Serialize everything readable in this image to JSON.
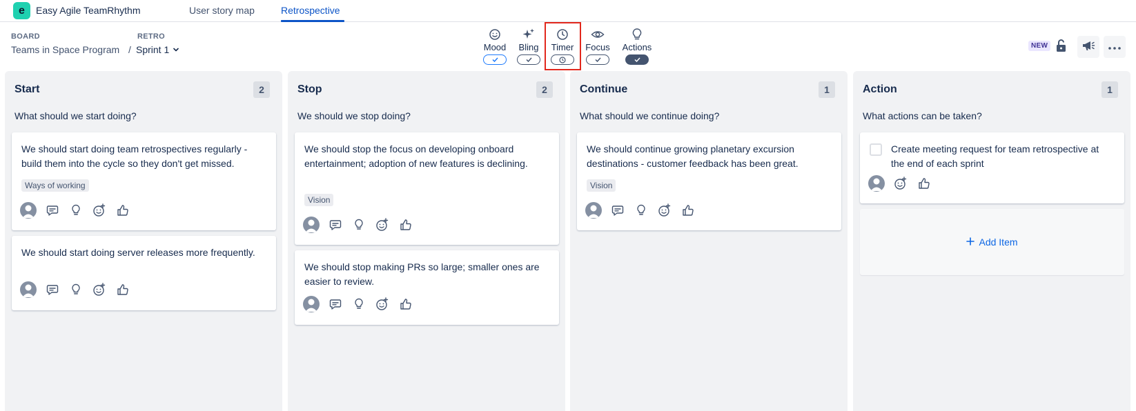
{
  "app": {
    "name": "Easy Agile TeamRhythm",
    "logo_letter": "e"
  },
  "nav": {
    "tabs": [
      {
        "label": "User story map"
      },
      {
        "label": "Retrospective"
      }
    ],
    "active_tab": "Retrospective"
  },
  "breadcrumb": {
    "board_label": "BOARD",
    "board_value": "Teams in Space Program",
    "separator": "/",
    "retro_label": "RETRO",
    "retro_value": "Sprint 1"
  },
  "toolbar": {
    "mood": "Mood",
    "bling": "Bling",
    "timer": "Timer",
    "focus": "Focus",
    "actions": "Actions",
    "highlighted": "Timer"
  },
  "header_right": {
    "new_badge": "NEW"
  },
  "columns": [
    {
      "title": "Start",
      "count": "2",
      "subtitle": "What should we start doing?",
      "cards": [
        {
          "text": "We should start doing team retrospectives regularly - build them into the cycle so they don't get missed.",
          "tag": "Ways of working"
        },
        {
          "text": "We should start doing server releases more frequently.",
          "tag": ""
        }
      ]
    },
    {
      "title": "Stop",
      "count": "2",
      "subtitle": "We should we stop doing?",
      "cards": [
        {
          "text": "We should stop the focus on developing onboard entertainment; adoption of new features is declining.",
          "tag": "Vision"
        },
        {
          "text": "We should stop making PRs so large; smaller ones are easier to review.",
          "tag": ""
        }
      ]
    },
    {
      "title": "Continue",
      "count": "1",
      "subtitle": "What should we continue doing?",
      "cards": [
        {
          "text": "We should continue growing planetary excursion destinations - customer feedback has been great.",
          "tag": "Vision"
        }
      ]
    },
    {
      "title": "Action",
      "count": "1",
      "subtitle": "What actions can be taken?",
      "cards": [
        {
          "text": "Create meeting request for team retrospective at the end of each sprint",
          "checked": false
        }
      ],
      "add_item": "Add Item"
    }
  ],
  "colors": {
    "accent": "#0c54c7",
    "logo": "#1fd1b0",
    "highlight": "#e2271c",
    "column_bg": "#f1f2f4"
  }
}
